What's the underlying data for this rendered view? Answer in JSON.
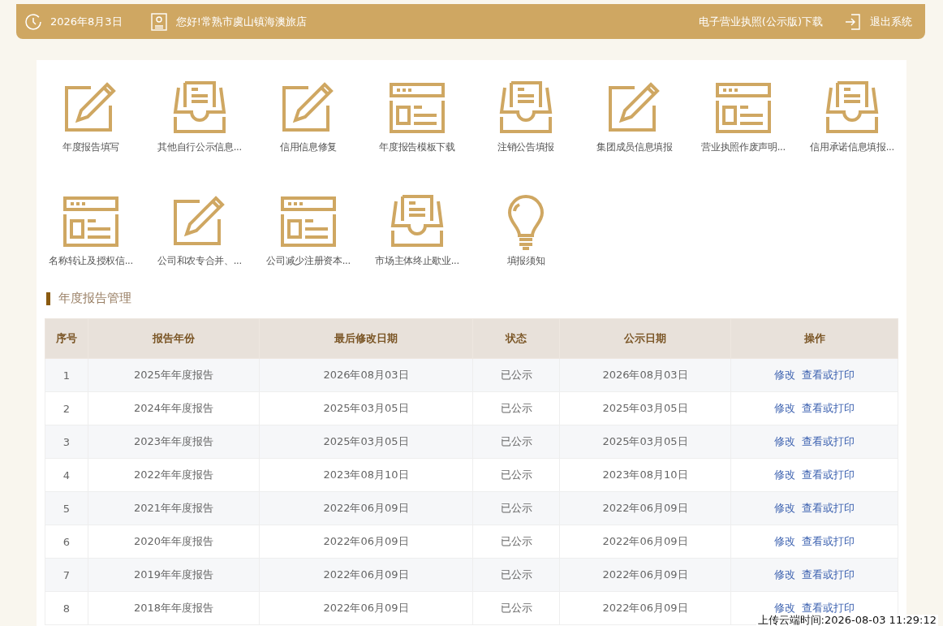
{
  "header": {
    "date": "2026年8月3日",
    "greeting": "您好!常熟市虞山镇海澳旅店",
    "license_link": "电子营业执照(公示版)下载",
    "logout": "退出系统"
  },
  "shortcuts": [
    {
      "kind": "pencil",
      "label": "年度报告填写"
    },
    {
      "kind": "tray",
      "label": "其他自行公示信息..."
    },
    {
      "kind": "pencil",
      "label": "信用信息修复"
    },
    {
      "kind": "window",
      "label": "年度报告模板下载"
    },
    {
      "kind": "tray",
      "label": "注销公告填报"
    },
    {
      "kind": "pencil",
      "label": "集团成员信息填报"
    },
    {
      "kind": "window",
      "label": "营业执照作废声明..."
    },
    {
      "kind": "tray",
      "label": "信用承诺信息填报..."
    },
    {
      "kind": "window",
      "label": "名称转让及授权信..."
    },
    {
      "kind": "pencil",
      "label": "公司和农专合并、..."
    },
    {
      "kind": "window",
      "label": "公司减少注册资本..."
    },
    {
      "kind": "tray",
      "label": "市场主体终止歇业..."
    },
    {
      "kind": "bulb",
      "label": "填报须知"
    }
  ],
  "section_title": "年度报告管理",
  "table": {
    "columns": [
      "序号",
      "报告年份",
      "最后修改日期",
      "状态",
      "公示日期",
      "操作"
    ],
    "rows": [
      {
        "no": "1",
        "year": "2025年年度报告",
        "modified": "2026年08月03日",
        "status": "已公示",
        "published": "2026年08月03日",
        "actions": [
          "修改",
          "查看或打印"
        ]
      },
      {
        "no": "2",
        "year": "2024年年度报告",
        "modified": "2025年03月05日",
        "status": "已公示",
        "published": "2025年03月05日",
        "actions": [
          "修改",
          "查看或打印"
        ]
      },
      {
        "no": "3",
        "year": "2023年年度报告",
        "modified": "2025年03月05日",
        "status": "已公示",
        "published": "2025年03月05日",
        "actions": [
          "修改",
          "查看或打印"
        ]
      },
      {
        "no": "4",
        "year": "2022年年度报告",
        "modified": "2023年08月10日",
        "status": "已公示",
        "published": "2023年08月10日",
        "actions": [
          "修改",
          "查看或打印"
        ]
      },
      {
        "no": "5",
        "year": "2021年年度报告",
        "modified": "2022年06月09日",
        "status": "已公示",
        "published": "2022年06月09日",
        "actions": [
          "修改",
          "查看或打印"
        ]
      },
      {
        "no": "6",
        "year": "2020年年度报告",
        "modified": "2022年06月09日",
        "status": "已公示",
        "published": "2022年06月09日",
        "actions": [
          "修改",
          "查看或打印"
        ]
      },
      {
        "no": "7",
        "year": "2019年年度报告",
        "modified": "2022年06月09日",
        "status": "已公示",
        "published": "2022年06月09日",
        "actions": [
          "修改",
          "查看或打印"
        ]
      },
      {
        "no": "8",
        "year": "2018年年度报告",
        "modified": "2022年06月09日",
        "status": "已公示",
        "published": "2022年06月09日",
        "actions": [
          "修改",
          "查看或打印"
        ]
      }
    ]
  },
  "upload_stamp": "上传云端时间:2026-08-03 11:29:12"
}
